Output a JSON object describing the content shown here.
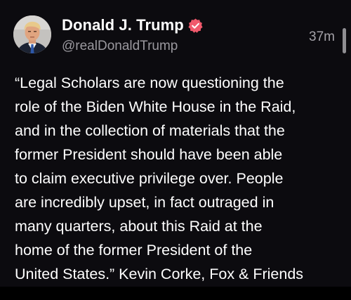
{
  "post": {
    "author": {
      "display_name": "Donald J. Trump",
      "handle": "@realDonaldTrump",
      "verified": true,
      "verified_icon": "verified-badge-icon",
      "avatar_icon": "avatar-photo"
    },
    "timestamp": "37m",
    "body_lines": [
      "“Legal Scholars are now questioning the",
      "role of the Biden White House in the Raid,",
      "and in the collection of materials that the",
      "former President should have been able",
      "to claim executive privilege over. People",
      "are incredibly upset, in fact outraged in",
      "many quarters, about this Raid at the",
      "home of the former President of the",
      "United States.” Kevin Corke, Fox & Friends"
    ]
  },
  "colors": {
    "background": "#0c0b0f",
    "text": "#ffffff",
    "secondary_text": "#9a989e",
    "verified_badge": "#f0596c"
  }
}
